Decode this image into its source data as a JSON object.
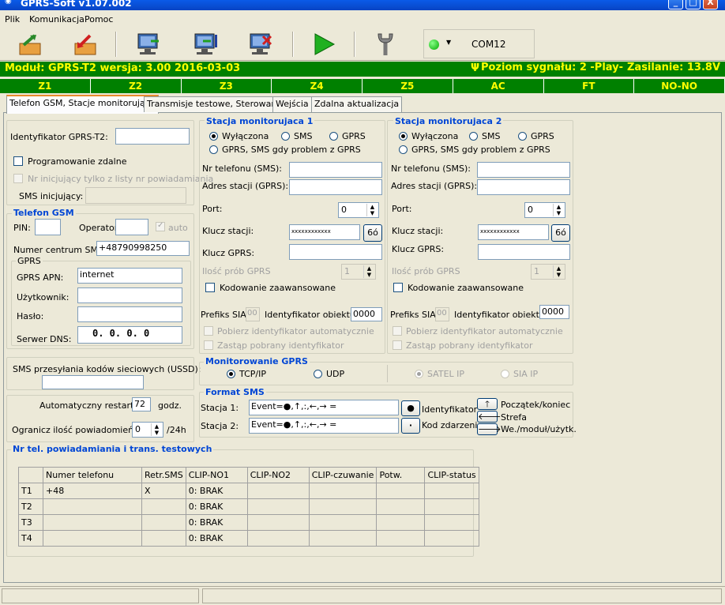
{
  "window": {
    "title": "GPRS-Soft v1.07.002",
    "min": "_",
    "max": "□",
    "close": "X"
  },
  "menu": [
    "Plik",
    "Komunikacja",
    "Pomoc"
  ],
  "toolbar": {
    "com_port": "COM12"
  },
  "status": {
    "module": "Moduł: GPRS-T2 wersja: 3.00  2016-03-03",
    "signal": "Poziom sygnału: 2 -Play-",
    "power": "Zasilanie: 13.8V"
  },
  "zones": [
    "Z1",
    "Z2",
    "Z3",
    "Z4",
    "Z5",
    "AC",
    "FT",
    "NO-NO"
  ],
  "tabs": [
    "Telefon GSM, Stacje monitorujące",
    "Transmisje testowe, Sterowanie",
    "Wejścia",
    "Zdalna aktualizacja"
  ],
  "left": {
    "id_label": "Identyfikator GPRS-T2:",
    "remote_prog": "Programowanie zdalne",
    "init_only": "Nr inicjujący tylko z listy nr powiadamiania",
    "sms_init": "SMS inicjujący:"
  },
  "gsm": {
    "legend": "Telefon GSM",
    "pin": "PIN:",
    "operator": "Operator:",
    "auto": "auto",
    "sms_center_label": "Numer centrum SMS:",
    "sms_center": "+48790998250",
    "gprs_legend": "GPRS",
    "apn_label": "GPRS APN:",
    "apn": "internet",
    "user_label": "Użytkownik:",
    "pass_label": "Hasło:",
    "dns_label": "Serwer DNS:",
    "dns": "0.  0.  0.  0"
  },
  "ussd": {
    "label": "SMS przesyłania kodów sieciowych (USSD):"
  },
  "restart": {
    "label": "Automatyczny restart co:",
    "value": "72",
    "unit": "godz."
  },
  "limit": {
    "label": "Ogranicz ilość powiadomień do:",
    "value": "0",
    "unit": "/24h"
  },
  "station": {
    "legend1": "Stacja monitorujaca 1",
    "legend2": "Stacja monitorujaca 2",
    "off": "Wyłączona",
    "sms": "SMS",
    "gprs": "GPRS",
    "gprs_sms": "GPRS, SMS gdy problem z GPRS",
    "phone": "Nr telefonu (SMS):",
    "addr": "Adres stacji (GPRS):",
    "port": "Port:",
    "port_val": "0",
    "key": "Klucz stacji:",
    "key_val": "xxxxxxxxxxxx",
    "key_btn": "6ó",
    "gprs_key": "Klucz GPRS:",
    "tries": "Ilość prób GPRS",
    "tries_val": "1",
    "adv": "Kodowanie zaawansowane",
    "sia_prefix": "Prefiks SIA:",
    "sia_val": "00",
    "obj_id": "Identyfikator  obiektu:",
    "obj_val": "0000",
    "auto_id": "Pobierz identyfikator automatycznie",
    "replace_id": "Zastąp pobrany identyfikator"
  },
  "monitoring": {
    "legend": "Monitorowanie GPRS",
    "tcp": "TCP/IP",
    "udp": "UDP",
    "satel": "SATEL IP",
    "sia": "SIA IP"
  },
  "format": {
    "legend": "Format SMS",
    "s1": "Stacja 1:",
    "s2": "Stacja 2:",
    "s1_val": "Event=●,↑,:,←,→ =",
    "s2_val": "Event=●,↑,:,←,→ =",
    "dot_big": "●",
    "dot_small": "·",
    "id_label": "Identyfikator",
    "code_label": "Kod zdarzenia",
    "up": "🡑",
    "left": "🡐",
    "right": "🡒",
    "start_end": "Początek/koniec",
    "zone": "Strefa",
    "in": "We./moduł/użytk."
  },
  "notify": {
    "legend": "Nr tel. powiadamiania i trans. testowych",
    "headers": [
      "",
      "Numer telefonu",
      "Retr.SMS",
      "CLIP-NO1",
      "CLIP-NO2",
      "CLIP-czuwanie",
      "Potw.",
      "CLIP-status"
    ],
    "rows": [
      [
        "T1",
        "+48",
        "X",
        "0: BRAK",
        "",
        "",
        "",
        ""
      ],
      [
        "T2",
        "",
        "",
        "0: BRAK",
        "",
        "",
        "",
        ""
      ],
      [
        "T3",
        "",
        "",
        "0: BRAK",
        "",
        "",
        "",
        ""
      ],
      [
        "T4",
        "",
        "",
        "0: BRAK",
        "",
        "",
        "",
        ""
      ]
    ]
  }
}
